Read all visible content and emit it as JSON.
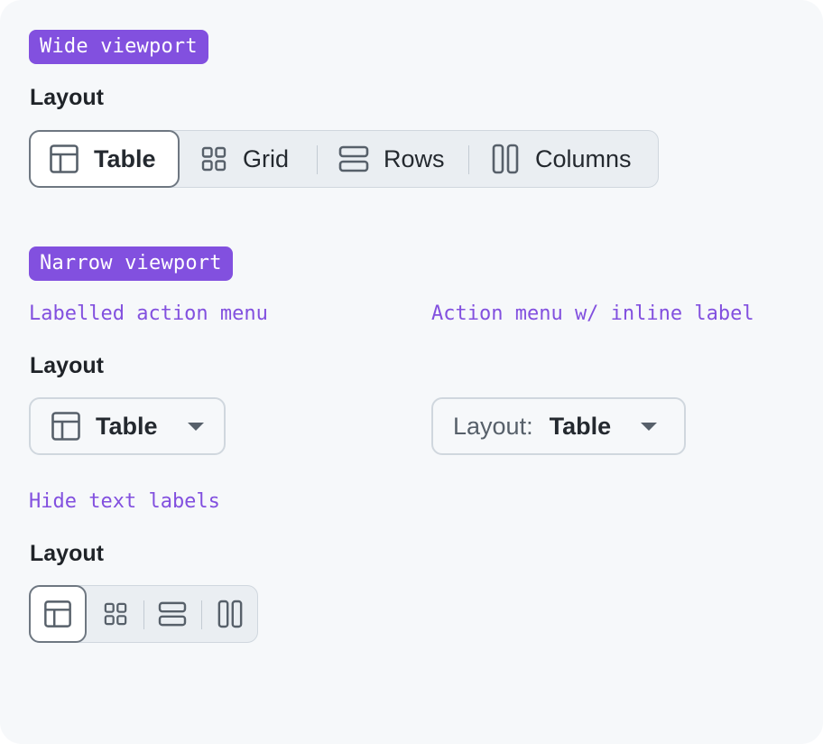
{
  "wide": {
    "badge": "Wide viewport",
    "field_label": "Layout",
    "options": [
      "Table",
      "Grid",
      "Rows",
      "Columns"
    ],
    "selected": "Table"
  },
  "narrow": {
    "badge": "Narrow viewport",
    "labelled_caption": "Labelled action menu",
    "labelled_field_label": "Layout",
    "labelled_value": "Table",
    "inline_caption": "Action menu w/ inline label",
    "inline_prefix": "Layout:",
    "inline_value": "Table",
    "hide_caption": "Hide text labels",
    "hide_field_label": "Layout"
  },
  "icons": [
    "table-icon",
    "grid-icon",
    "rows-icon",
    "columns-icon",
    "triangle-down-icon"
  ],
  "colors": {
    "accent": "#8250df",
    "canvas": "#f6f8fa",
    "control_bg": "#eaeef2",
    "selected_border": "#6e7781"
  }
}
